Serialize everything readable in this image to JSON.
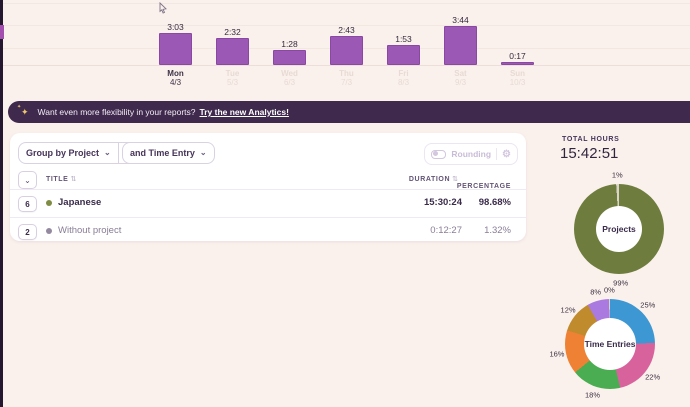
{
  "banner": {
    "icon": "sparkles-icon",
    "text": "Want even more flexibility in your reports?",
    "link_text": "Try the new Analytics!"
  },
  "filters": {
    "group_by_label": "Group by Project",
    "secondary_label": "and Time Entry",
    "rounding_label": "Rounding"
  },
  "table": {
    "headers": {
      "title": "TITLE",
      "duration": "DURATION",
      "percentage": "PERCENTAGE"
    },
    "rows": [
      {
        "count": "6",
        "title": "Japanese",
        "dot_color": "#7e8d43",
        "duration": "15:30:24",
        "percentage": "98.68%"
      },
      {
        "count": "2",
        "title": "Without project",
        "dot_color": "#948aa0",
        "duration": "0:12:27",
        "percentage": "1.32%"
      }
    ]
  },
  "summary": {
    "total_hours_label": "TOTAL HOURS",
    "total_hours_value": "15:42:51"
  },
  "chart_data": [
    {
      "type": "bar",
      "name": "daily-tracked-time",
      "categories": [
        "Mon",
        "Tue",
        "Wed",
        "Thu",
        "Fri",
        "Sat",
        "Sun"
      ],
      "dates": [
        "4/3",
        "5/3",
        "6/3",
        "7/3",
        "8/3",
        "9/3",
        "10/3"
      ],
      "value_labels": [
        "3:03",
        "2:32",
        "1:28",
        "2:43",
        "1:53",
        "3:44",
        "0:17"
      ],
      "values_minutes": [
        183,
        152,
        88,
        163,
        113,
        224,
        17
      ],
      "bar_color": "#9c58b5",
      "active_index": 0,
      "ylim_minutes": [
        0,
        252
      ],
      "grid": "horizontal"
    },
    {
      "type": "donut",
      "title": "Projects",
      "labels": [
        "99%",
        "1%"
      ],
      "values": [
        99,
        1
      ],
      "colors": [
        "#6e7d3e",
        "#dbd5c9"
      ]
    },
    {
      "type": "donut",
      "title": "Time Entries",
      "labels": [
        "25%",
        "22%",
        "18%",
        "16%",
        "12%",
        "8%",
        "0%"
      ],
      "values": [
        25,
        22,
        18,
        16,
        12,
        8,
        0
      ],
      "colors": [
        "#3d97d3",
        "#d8639c",
        "#4aad51",
        "#ee8133",
        "#c08b2d",
        "#ab7ae0",
        "#dbd5c9"
      ]
    }
  ]
}
